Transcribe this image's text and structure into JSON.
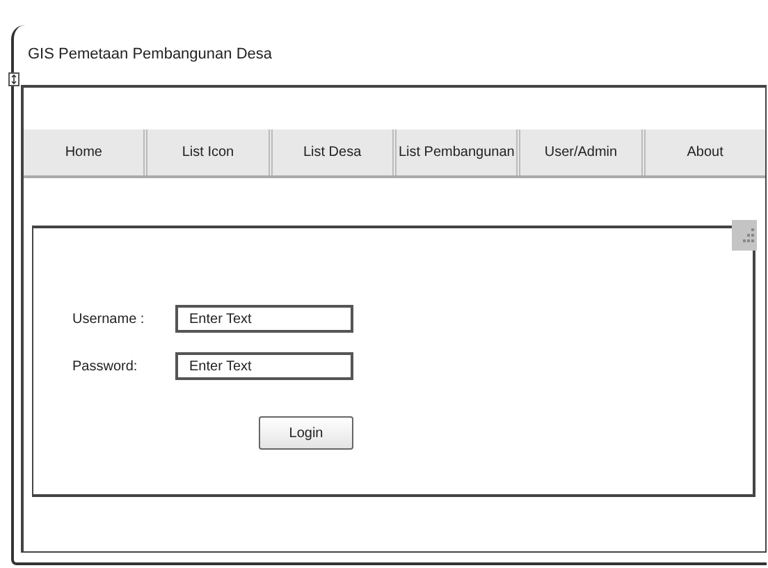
{
  "window": {
    "title": "GIS Pemetaan Pembangunan Desa"
  },
  "nav": [
    {
      "label": "Home"
    },
    {
      "label": "List Icon"
    },
    {
      "label": "List Desa"
    },
    {
      "label": "List Pembangunan"
    },
    {
      "label": "User/Admin"
    },
    {
      "label": "About"
    }
  ],
  "login": {
    "fields": [
      {
        "label": "Username :",
        "placeholder": "Enter Text"
      },
      {
        "label": "Password:",
        "placeholder": "Enter Text"
      }
    ],
    "button": "Login"
  }
}
